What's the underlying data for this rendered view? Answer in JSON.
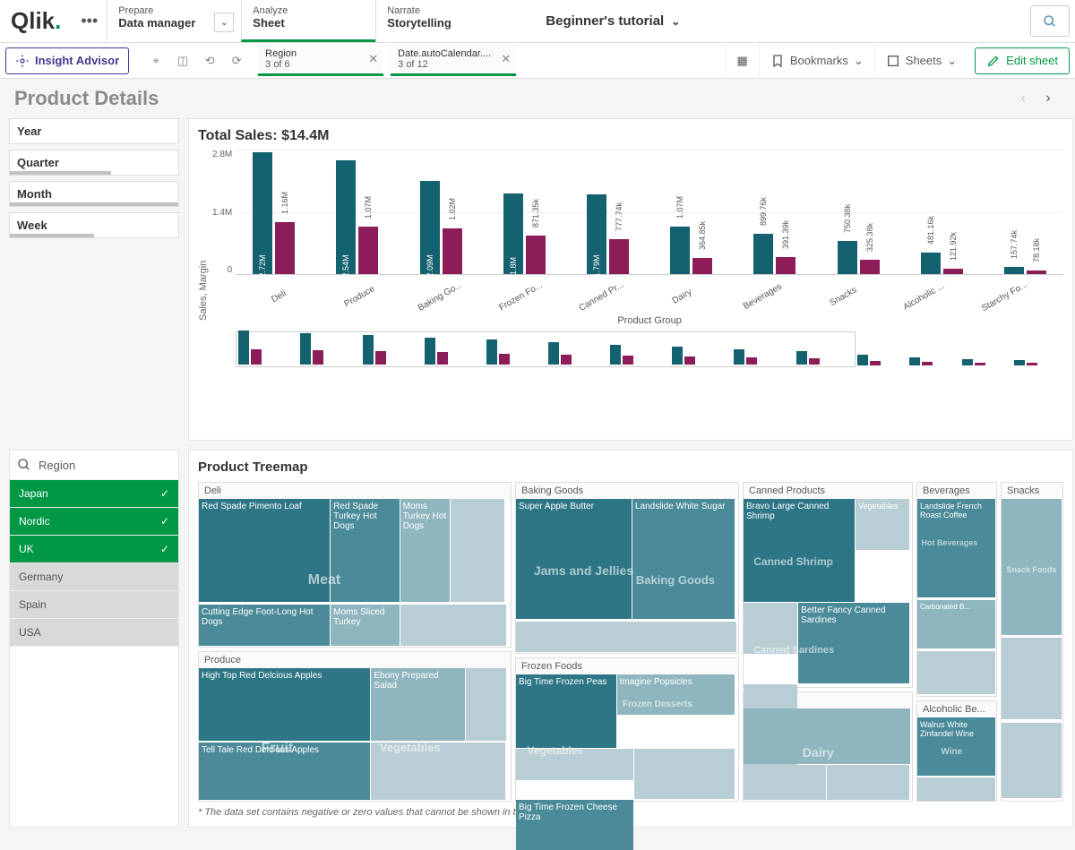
{
  "logo": "Qlik",
  "nav": [
    {
      "label": "Prepare",
      "value": "Data manager"
    },
    {
      "label": "Analyze",
      "value": "Sheet"
    },
    {
      "label": "Narrate",
      "value": "Storytelling"
    }
  ],
  "app_title": "Beginner's tutorial",
  "insight_label": "Insight Advisor",
  "selections": [
    {
      "field": "Region",
      "sub": "3 of 6"
    },
    {
      "field": "Date.autoCalendar....",
      "sub": "3 of 12"
    }
  ],
  "toolbar": {
    "bookmarks": "Bookmarks",
    "sheets": "Sheets",
    "edit": "Edit sheet"
  },
  "sheet_title": "Product Details",
  "filters": [
    {
      "label": "Year",
      "bar": 0
    },
    {
      "label": "Quarter",
      "bar": 60
    },
    {
      "label": "Month",
      "bar": 100
    },
    {
      "label": "Week",
      "bar": 50
    }
  ],
  "chart_data": {
    "type": "bar",
    "title": "Total Sales: $14.4M",
    "ylabel": "Sales, Margin",
    "xlabel": "Product Group",
    "ylim": [
      0,
      2.8
    ],
    "yticks": [
      "2.8M",
      "1.4M",
      "0"
    ],
    "categories": [
      "Deli",
      "Produce",
      "Baking Go...",
      "Frozen Fo...",
      "Canned Pr...",
      "Dairy",
      "Beverages",
      "Snacks",
      "Alcoholic ...",
      "Starchy Fo..."
    ],
    "series": [
      {
        "name": "Sales",
        "values": [
          2.72,
          2.54,
          2.09,
          1.8,
          1.79,
          1.07,
          0.9,
          0.75,
          0.48,
          0.16
        ],
        "labels": [
          "2.72M",
          "2.54M",
          "2.09M",
          "1.8M",
          "1.79M",
          "1.07M",
          "899.76k",
          "750.38k",
          "481.16k",
          "157.74k"
        ]
      },
      {
        "name": "Margin",
        "values": [
          1.16,
          1.07,
          1.02,
          0.87,
          0.78,
          0.36,
          0.39,
          0.33,
          0.12,
          0.08
        ],
        "labels": [
          "1.16M",
          "1.07M",
          "1.02M",
          "871.35k",
          "777.74k",
          "364.85k",
          "391.39k",
          "325.38k",
          "121.92k",
          "78.18k"
        ]
      }
    ]
  },
  "region": {
    "title": "Region",
    "items": [
      {
        "name": "Japan",
        "selected": true
      },
      {
        "name": "Nordic",
        "selected": true
      },
      {
        "name": "UK",
        "selected": true
      },
      {
        "name": "Germany",
        "selected": false
      },
      {
        "name": "Spain",
        "selected": false
      },
      {
        "name": "USA",
        "selected": false
      }
    ]
  },
  "treemap": {
    "title": "Product Treemap",
    "footnote": "* The data set contains negative or zero values that cannot be shown in this chart.",
    "groups": {
      "deli": {
        "title": "Deli",
        "ghost": "Meat",
        "cells": [
          "Red Spade Pimento Loaf",
          "Red Spade Turkey Hot Dogs",
          "Moms Turkey Hot Dogs",
          "Cutting Edge Foot-Long Hot Dogs",
          "Moms Sliced Turkey"
        ]
      },
      "produce": {
        "title": "Produce",
        "ghost1": "Fruit",
        "ghost2": "Vegetables",
        "cells": [
          "High Top Red Delcious Apples",
          "Ebony Prepared Salad",
          "Tell Tale Red Delcious Apples"
        ]
      },
      "baking": {
        "title": "Baking Goods",
        "ghost1": "Jams and Jellies",
        "ghost2": "Baking Goods",
        "cells": [
          "Super Apple Butter",
          "Landslide White Sugar"
        ]
      },
      "frozen": {
        "title": "Frozen Foods",
        "ghost1": "Vegetables",
        "ghost2": "Frozen Desserts",
        "cells": [
          "Big Time Frozen Peas",
          "Imagine Popsicles",
          "Big Time Frozen Cheese Pizza"
        ]
      },
      "canned": {
        "title": "Canned Products",
        "ghost1": "Canned Shrimp",
        "ghost2": "Canned Sardines",
        "cells": [
          "Bravo Large Canned Shrimp",
          "Better Fancy Canned Sardines"
        ],
        "veg": "Vegetables"
      },
      "dairy": {
        "title": "Dairy",
        "ghost": "Dairy"
      },
      "beverages": {
        "title": "Beverages",
        "ghost": "Hot Beverages",
        "cells": [
          "Landslide French Roast Coffee"
        ],
        "carb": "Carbonated B..."
      },
      "alcoholic": {
        "title": "Alcoholic Be...",
        "ghost": "Wine",
        "cells": [
          "Walrus White Zinfandel Wine"
        ]
      },
      "snacks": {
        "title": "Snacks",
        "ghost": "Snack Foods"
      }
    }
  }
}
